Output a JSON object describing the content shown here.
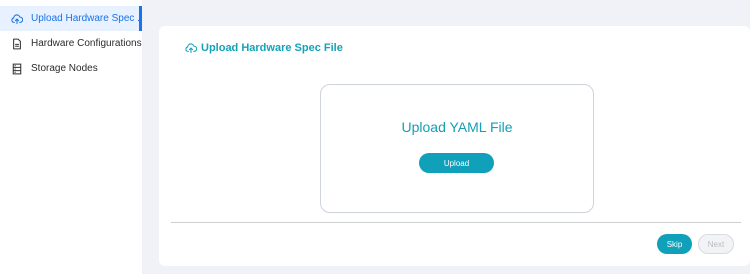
{
  "sidebar": {
    "items": [
      {
        "label": "Upload Hardware Spec ...",
        "icon": "upload-cloud-icon",
        "active": true
      },
      {
        "label": "Hardware Configurations",
        "icon": "document-icon",
        "active": false
      },
      {
        "label": "Storage Nodes",
        "icon": "server-icon",
        "active": false
      }
    ]
  },
  "main": {
    "card_title": "Upload Hardware Spec File",
    "upload_heading": "Upload YAML File",
    "upload_button": "Upload",
    "skip_button": "Skip",
    "next_button": "Next"
  },
  "colors": {
    "accent": "#10a0b9",
    "sidebar_active_bg": "#e7f1ff",
    "sidebar_active_text": "#1a73e8",
    "main_bg": "#f1f2f7"
  }
}
